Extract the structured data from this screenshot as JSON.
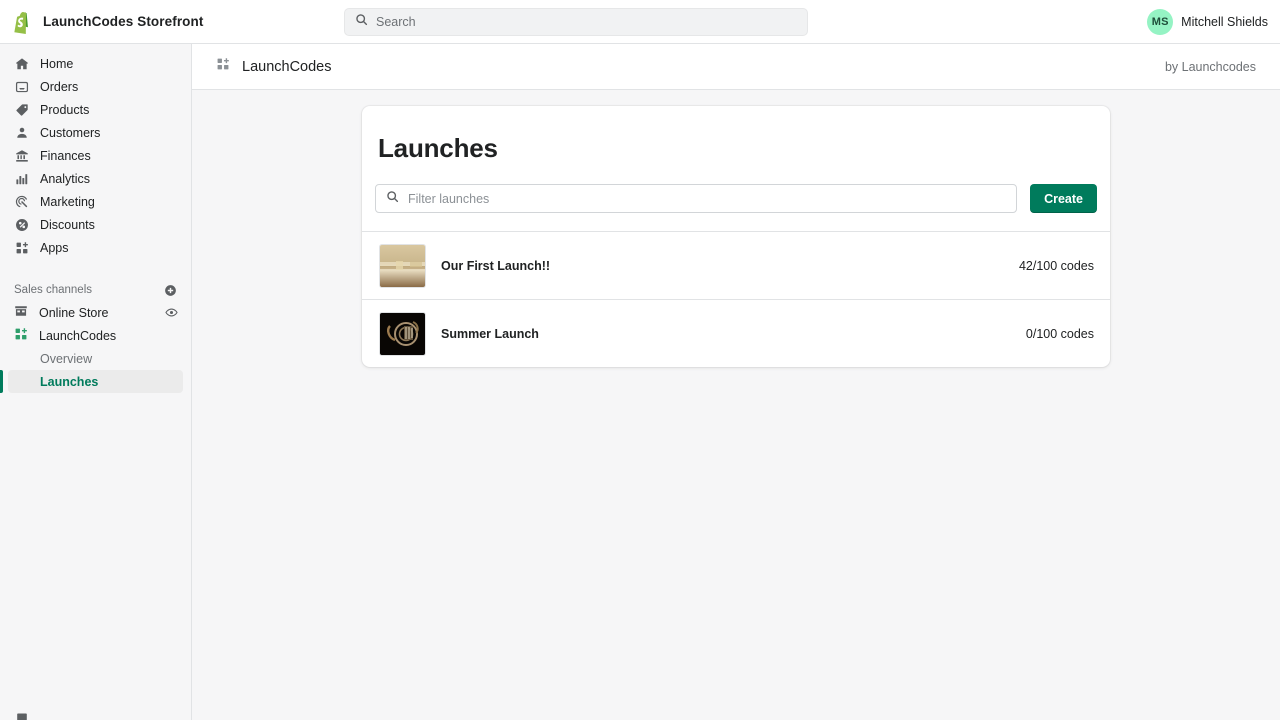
{
  "topbar": {
    "logo_icon": "shopify-bag-icon",
    "store_name": "LaunchCodes Storefront",
    "search": {
      "icon": "search-icon",
      "value": "",
      "placeholder": "Search"
    },
    "user": {
      "initials": "MS",
      "name": "Mitchell Shields",
      "avatar_bg": "#95f3c4"
    }
  },
  "sidebar": {
    "items": [
      {
        "label": "Home",
        "icon": "home-icon"
      },
      {
        "label": "Orders",
        "icon": "orders-inbox-icon"
      },
      {
        "label": "Products",
        "icon": "price-tag-icon"
      },
      {
        "label": "Customers",
        "icon": "person-icon"
      },
      {
        "label": "Finances",
        "icon": "bank-icon"
      },
      {
        "label": "Analytics",
        "icon": "bar-chart-icon"
      },
      {
        "label": "Marketing",
        "icon": "megaphone-target-icon"
      },
      {
        "label": "Discounts",
        "icon": "discount-percent-icon"
      },
      {
        "label": "Apps",
        "icon": "apps-grid-icon"
      }
    ],
    "sales_channels": {
      "title": "Sales channels",
      "add_icon": "plus-circle-icon",
      "channels": [
        {
          "label": "Online Store",
          "icon": "storefront-icon",
          "action_icon": "eye-icon"
        },
        {
          "label": "LaunchCodes",
          "icon": "launchcodes-grid-icon",
          "action_icon": ""
        }
      ],
      "sub_items": [
        {
          "label": "Overview",
          "active": false
        },
        {
          "label": "Launches",
          "active": true
        }
      ]
    },
    "active_color": "#007b5c"
  },
  "breadcrumb": {
    "icon": "launchcodes-grid-icon",
    "title": "LaunchCodes",
    "by_line": "by Launchcodes"
  },
  "main": {
    "card_title": "Launches",
    "filter": {
      "icon": "search-icon",
      "value": "",
      "placeholder": "Filter launches"
    },
    "create_label": "Create",
    "create_color": "#007b5c",
    "launches": [
      {
        "name": "Our First Launch!!",
        "codes": "42/100 codes",
        "thumbnail": "blurred-tan-interior-photo"
      },
      {
        "name": "Summer Launch",
        "codes": "0/100 codes",
        "thumbnail": "french-horn-on-black-photo"
      }
    ]
  }
}
